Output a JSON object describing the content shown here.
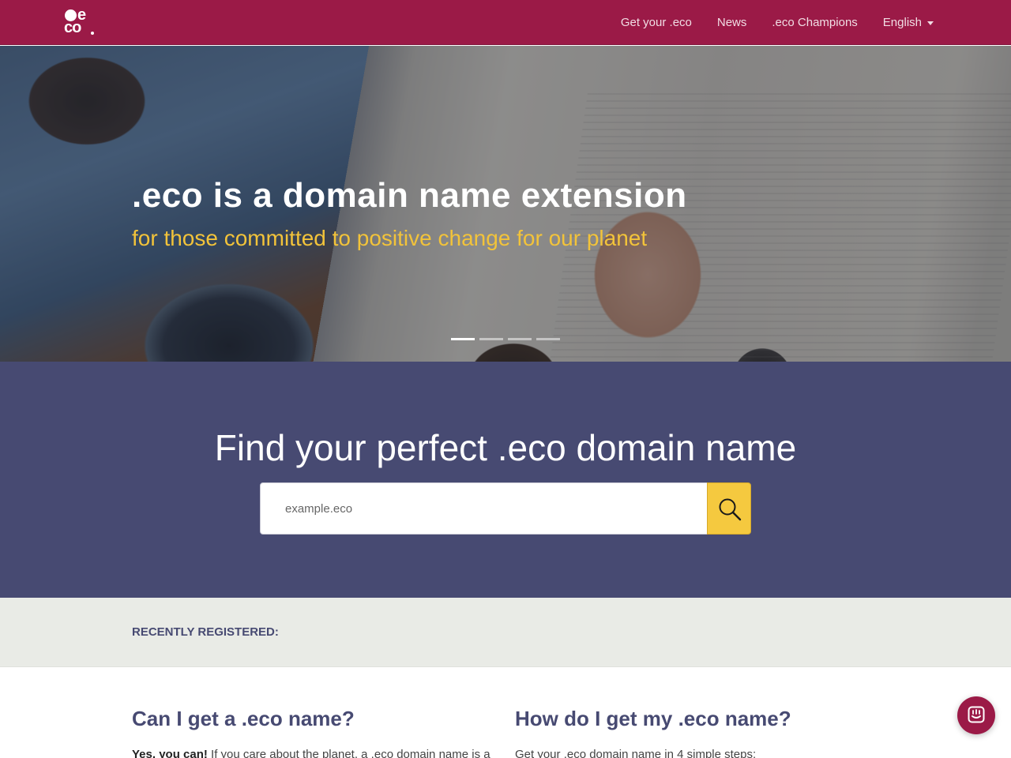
{
  "brand": {
    "logo_text_top": "e",
    "logo_text_bottom": "co"
  },
  "nav": {
    "links": [
      {
        "label": "Get your .eco"
      },
      {
        "label": "News"
      },
      {
        "label": ".eco Champions"
      }
    ],
    "language": "English"
  },
  "hero": {
    "title": ".eco is a domain name extension",
    "subtitle": "for those committed to positive change for our planet",
    "slide_count": 4,
    "active_slide": 1
  },
  "search": {
    "title": "Find your perfect .eco domain name",
    "placeholder": "example.eco",
    "button_icon": "search-icon"
  },
  "recent": {
    "label": "RECENTLY REGISTERED:"
  },
  "content": {
    "left": {
      "heading": "Can I get a .eco name?",
      "lead_bold": "Yes, you can!",
      "lead_text": " If you care about the planet, a .eco domain name is a"
    },
    "right": {
      "heading": "How do I get my .eco name?",
      "text": "Get your .eco domain name in 4 simple steps:"
    }
  },
  "chat": {
    "icon": "chat-icon"
  },
  "colors": {
    "brand": "#9b1a47",
    "navy": "#474a72",
    "accent": "#f2c33a",
    "recent_bg": "#e9ebe6"
  }
}
